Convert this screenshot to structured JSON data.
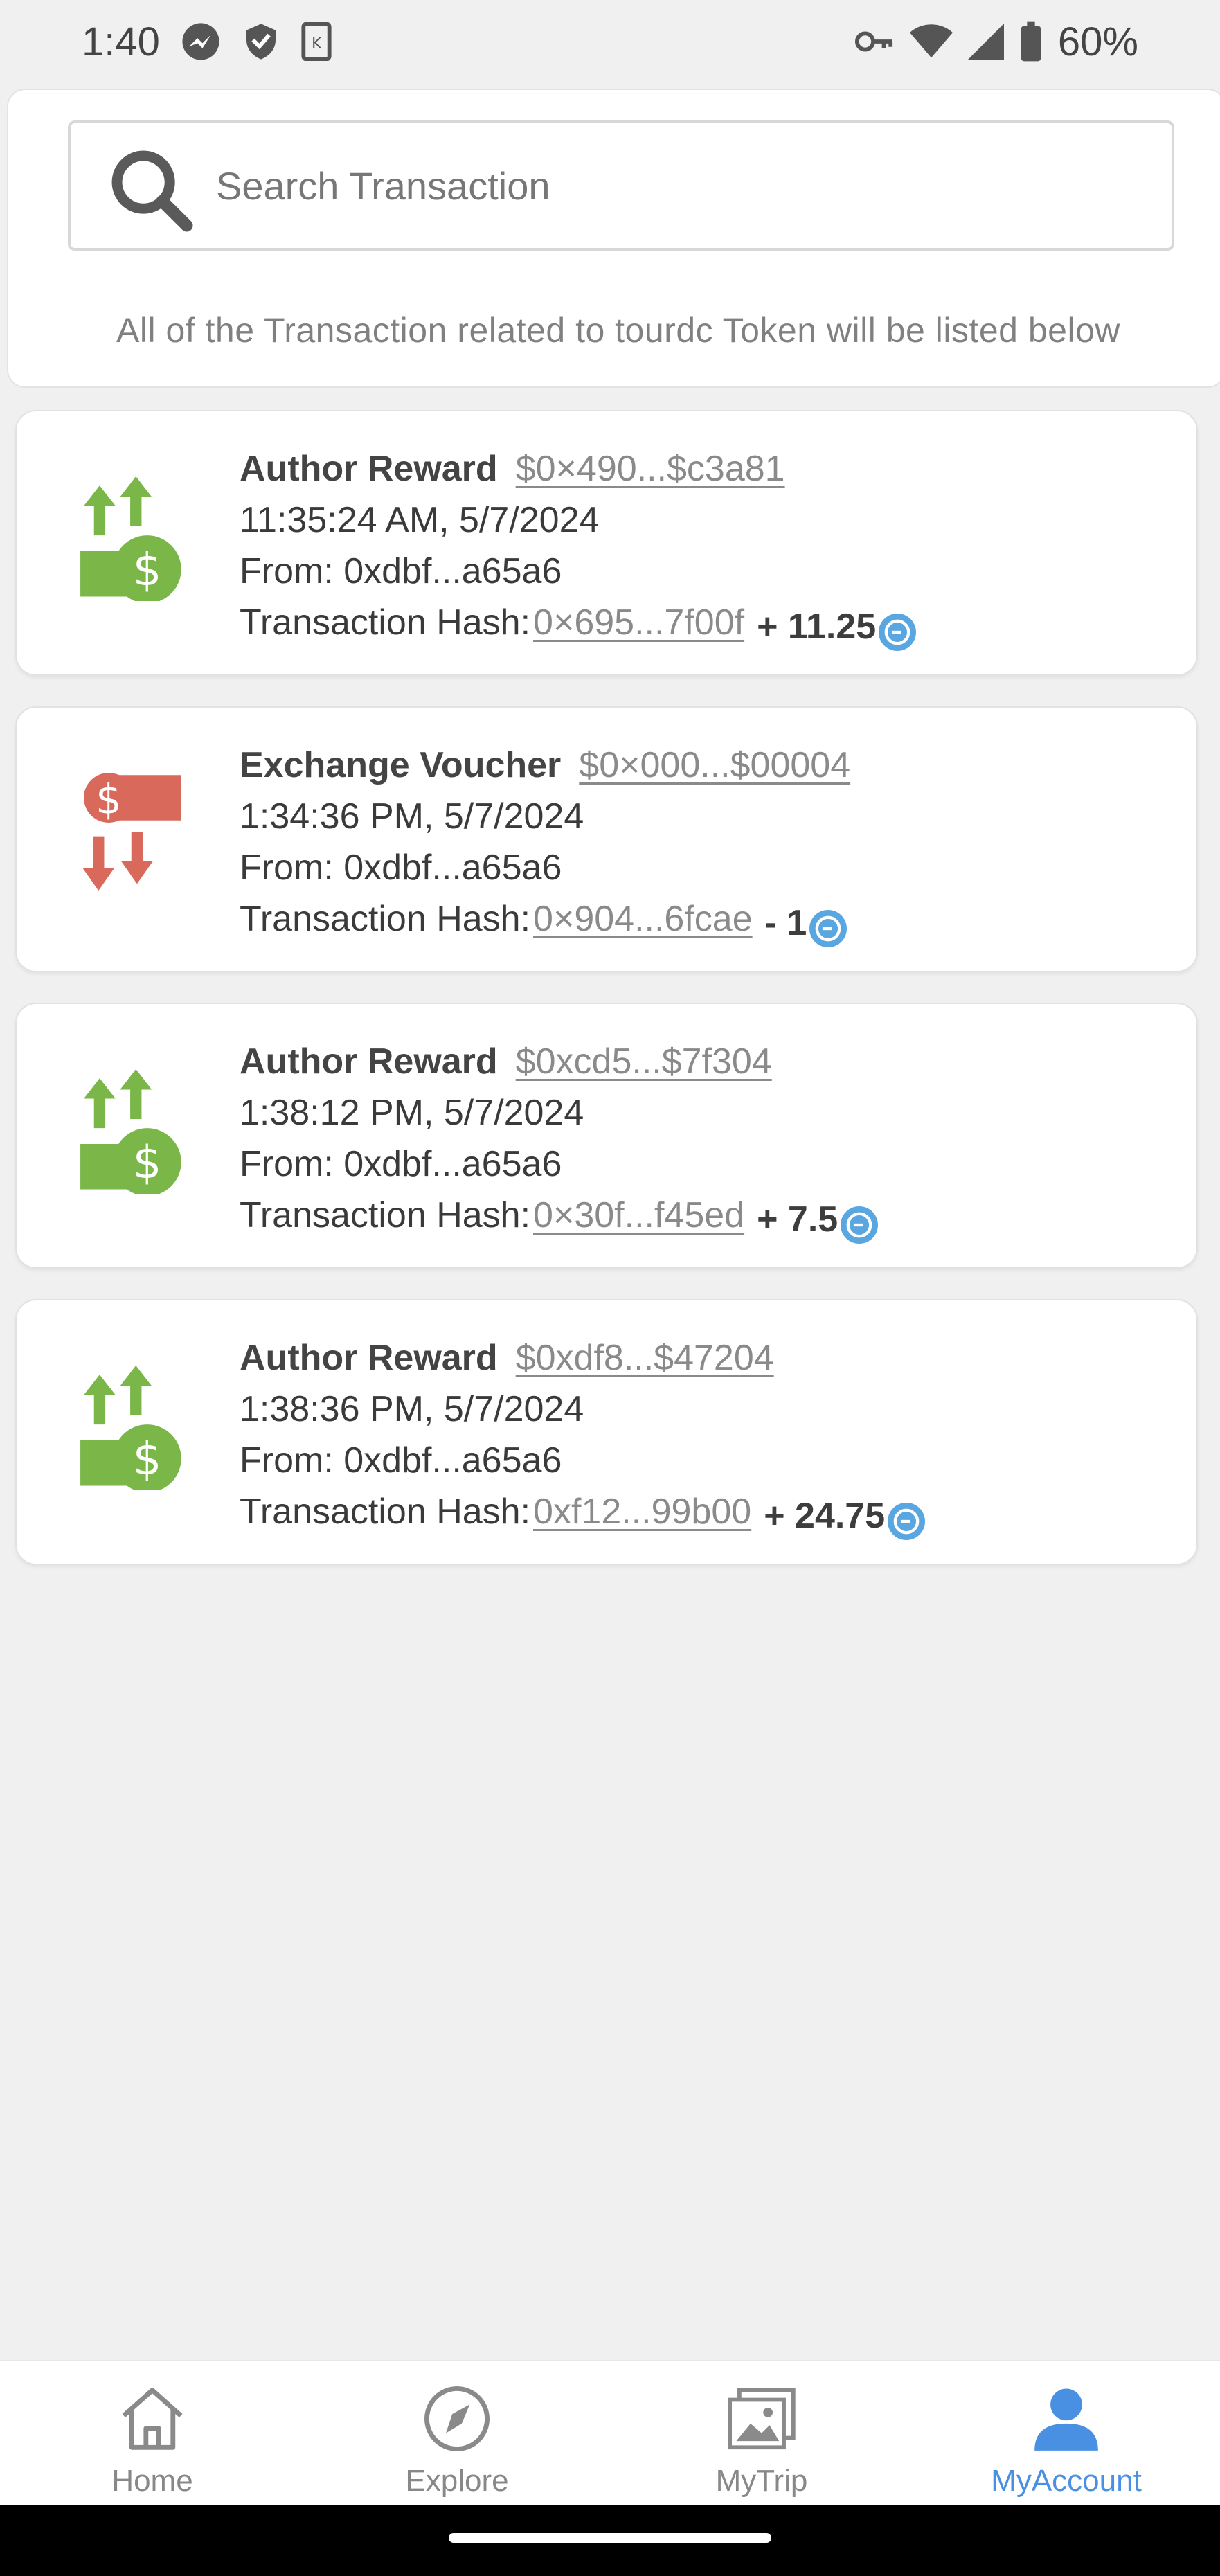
{
  "status_bar": {
    "time": "1:40",
    "battery": "60%",
    "icons_left": [
      "messenger-icon",
      "shield-icon",
      "k-app-icon"
    ],
    "icons_right": [
      "key-icon",
      "wifi-icon",
      "signal-icon",
      "battery-icon"
    ]
  },
  "search": {
    "placeholder": "Search Transaction",
    "note": "All of the Transaction related to tourdc Token will be listed below"
  },
  "transactions": [
    {
      "type": "Author Reward",
      "direction": "in",
      "ref": "$0×490...$c3a81",
      "time": "11:35:24 AM, 5/7/2024",
      "from": "From: 0xdbf...a65a6",
      "hash_label": "Transaction Hash:",
      "hash": "0×695...7f00f",
      "amount": "+ 11.25"
    },
    {
      "type": "Exchange Voucher",
      "direction": "out",
      "ref": "$0×000...$00004",
      "time": "1:34:36 PM, 5/7/2024",
      "from": "From: 0xdbf...a65a6",
      "hash_label": "Transaction Hash:",
      "hash": "0×904...6fcae",
      "amount": "- 1"
    },
    {
      "type": "Author Reward",
      "direction": "in",
      "ref": "$0xcd5...$7f304",
      "time": "1:38:12 PM, 5/7/2024",
      "from": "From: 0xdbf...a65a6",
      "hash_label": "Transaction Hash:",
      "hash": "0×30f...f45ed",
      "amount": "+ 7.5"
    },
    {
      "type": "Author Reward",
      "direction": "in",
      "ref": "$0xdf8...$47204",
      "time": "1:38:36 PM, 5/7/2024",
      "from": "From: 0xdbf...a65a6",
      "hash_label": "Transaction Hash:",
      "hash": "0xf12...99b00",
      "amount": "+ 24.75"
    }
  ],
  "nav": {
    "items": [
      {
        "label": "Home",
        "icon": "home-icon",
        "active": false
      },
      {
        "label": "Explore",
        "icon": "compass-icon",
        "active": false
      },
      {
        "label": "MyTrip",
        "icon": "image-icon",
        "active": false
      },
      {
        "label": "MyAccount",
        "icon": "user-icon",
        "active": true
      }
    ]
  },
  "colors": {
    "income_green": "#7ab648",
    "expense_red": "#d9695b",
    "coin_blue": "#5aa6e0",
    "active_blue": "#4a90e2"
  }
}
